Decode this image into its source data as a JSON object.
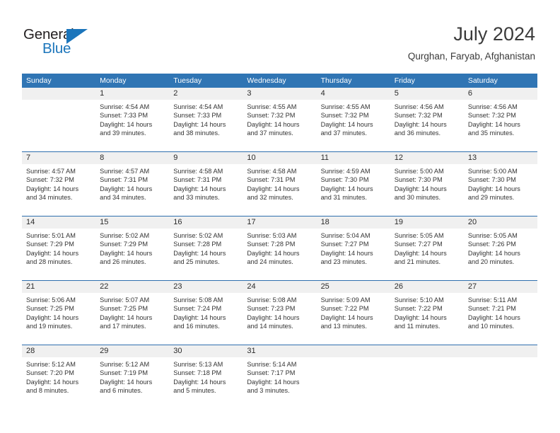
{
  "brand": {
    "name_part1": "General",
    "name_part2": "Blue",
    "triangle_color": "#1b75bb",
    "text_color": "#231f20"
  },
  "header": {
    "title": "July 2024",
    "location": "Qurghan, Faryab, Afghanistan"
  },
  "theme": {
    "header_blue": "#3075b4",
    "row_divider_blue": "#2f6fae",
    "day_band_gray": "#f0f0f0",
    "body_white": "#ffffff",
    "text_dark": "#333333"
  },
  "weekdays": [
    "Sunday",
    "Monday",
    "Tuesday",
    "Wednesday",
    "Thursday",
    "Friday",
    "Saturday"
  ],
  "weeks": [
    [
      {
        "day": "",
        "lines": [
          "",
          "",
          "",
          ""
        ],
        "empty": true
      },
      {
        "day": "1",
        "lines": [
          "Sunrise: 4:54 AM",
          "Sunset: 7:33 PM",
          "Daylight: 14 hours",
          "and 39 minutes."
        ],
        "empty": false
      },
      {
        "day": "2",
        "lines": [
          "Sunrise: 4:54 AM",
          "Sunset: 7:33 PM",
          "Daylight: 14 hours",
          "and 38 minutes."
        ],
        "empty": false
      },
      {
        "day": "3",
        "lines": [
          "Sunrise: 4:55 AM",
          "Sunset: 7:32 PM",
          "Daylight: 14 hours",
          "and 37 minutes."
        ],
        "empty": false
      },
      {
        "day": "4",
        "lines": [
          "Sunrise: 4:55 AM",
          "Sunset: 7:32 PM",
          "Daylight: 14 hours",
          "and 37 minutes."
        ],
        "empty": false
      },
      {
        "day": "5",
        "lines": [
          "Sunrise: 4:56 AM",
          "Sunset: 7:32 PM",
          "Daylight: 14 hours",
          "and 36 minutes."
        ],
        "empty": false
      },
      {
        "day": "6",
        "lines": [
          "Sunrise: 4:56 AM",
          "Sunset: 7:32 PM",
          "Daylight: 14 hours",
          "and 35 minutes."
        ],
        "empty": false
      }
    ],
    [
      {
        "day": "7",
        "lines": [
          "Sunrise: 4:57 AM",
          "Sunset: 7:32 PM",
          "Daylight: 14 hours",
          "and 34 minutes."
        ],
        "empty": false
      },
      {
        "day": "8",
        "lines": [
          "Sunrise: 4:57 AM",
          "Sunset: 7:31 PM",
          "Daylight: 14 hours",
          "and 34 minutes."
        ],
        "empty": false
      },
      {
        "day": "9",
        "lines": [
          "Sunrise: 4:58 AM",
          "Sunset: 7:31 PM",
          "Daylight: 14 hours",
          "and 33 minutes."
        ],
        "empty": false
      },
      {
        "day": "10",
        "lines": [
          "Sunrise: 4:58 AM",
          "Sunset: 7:31 PM",
          "Daylight: 14 hours",
          "and 32 minutes."
        ],
        "empty": false
      },
      {
        "day": "11",
        "lines": [
          "Sunrise: 4:59 AM",
          "Sunset: 7:30 PM",
          "Daylight: 14 hours",
          "and 31 minutes."
        ],
        "empty": false
      },
      {
        "day": "12",
        "lines": [
          "Sunrise: 5:00 AM",
          "Sunset: 7:30 PM",
          "Daylight: 14 hours",
          "and 30 minutes."
        ],
        "empty": false
      },
      {
        "day": "13",
        "lines": [
          "Sunrise: 5:00 AM",
          "Sunset: 7:30 PM",
          "Daylight: 14 hours",
          "and 29 minutes."
        ],
        "empty": false
      }
    ],
    [
      {
        "day": "14",
        "lines": [
          "Sunrise: 5:01 AM",
          "Sunset: 7:29 PM",
          "Daylight: 14 hours",
          "and 28 minutes."
        ],
        "empty": false
      },
      {
        "day": "15",
        "lines": [
          "Sunrise: 5:02 AM",
          "Sunset: 7:29 PM",
          "Daylight: 14 hours",
          "and 26 minutes."
        ],
        "empty": false
      },
      {
        "day": "16",
        "lines": [
          "Sunrise: 5:02 AM",
          "Sunset: 7:28 PM",
          "Daylight: 14 hours",
          "and 25 minutes."
        ],
        "empty": false
      },
      {
        "day": "17",
        "lines": [
          "Sunrise: 5:03 AM",
          "Sunset: 7:28 PM",
          "Daylight: 14 hours",
          "and 24 minutes."
        ],
        "empty": false
      },
      {
        "day": "18",
        "lines": [
          "Sunrise: 5:04 AM",
          "Sunset: 7:27 PM",
          "Daylight: 14 hours",
          "and 23 minutes."
        ],
        "empty": false
      },
      {
        "day": "19",
        "lines": [
          "Sunrise: 5:05 AM",
          "Sunset: 7:27 PM",
          "Daylight: 14 hours",
          "and 21 minutes."
        ],
        "empty": false
      },
      {
        "day": "20",
        "lines": [
          "Sunrise: 5:05 AM",
          "Sunset: 7:26 PM",
          "Daylight: 14 hours",
          "and 20 minutes."
        ],
        "empty": false
      }
    ],
    [
      {
        "day": "21",
        "lines": [
          "Sunrise: 5:06 AM",
          "Sunset: 7:25 PM",
          "Daylight: 14 hours",
          "and 19 minutes."
        ],
        "empty": false
      },
      {
        "day": "22",
        "lines": [
          "Sunrise: 5:07 AM",
          "Sunset: 7:25 PM",
          "Daylight: 14 hours",
          "and 17 minutes."
        ],
        "empty": false
      },
      {
        "day": "23",
        "lines": [
          "Sunrise: 5:08 AM",
          "Sunset: 7:24 PM",
          "Daylight: 14 hours",
          "and 16 minutes."
        ],
        "empty": false
      },
      {
        "day": "24",
        "lines": [
          "Sunrise: 5:08 AM",
          "Sunset: 7:23 PM",
          "Daylight: 14 hours",
          "and 14 minutes."
        ],
        "empty": false
      },
      {
        "day": "25",
        "lines": [
          "Sunrise: 5:09 AM",
          "Sunset: 7:22 PM",
          "Daylight: 14 hours",
          "and 13 minutes."
        ],
        "empty": false
      },
      {
        "day": "26",
        "lines": [
          "Sunrise: 5:10 AM",
          "Sunset: 7:22 PM",
          "Daylight: 14 hours",
          "and 11 minutes."
        ],
        "empty": false
      },
      {
        "day": "27",
        "lines": [
          "Sunrise: 5:11 AM",
          "Sunset: 7:21 PM",
          "Daylight: 14 hours",
          "and 10 minutes."
        ],
        "empty": false
      }
    ],
    [
      {
        "day": "28",
        "lines": [
          "Sunrise: 5:12 AM",
          "Sunset: 7:20 PM",
          "Daylight: 14 hours",
          "and 8 minutes."
        ],
        "empty": false
      },
      {
        "day": "29",
        "lines": [
          "Sunrise: 5:12 AM",
          "Sunset: 7:19 PM",
          "Daylight: 14 hours",
          "and 6 minutes."
        ],
        "empty": false
      },
      {
        "day": "30",
        "lines": [
          "Sunrise: 5:13 AM",
          "Sunset: 7:18 PM",
          "Daylight: 14 hours",
          "and 5 minutes."
        ],
        "empty": false
      },
      {
        "day": "31",
        "lines": [
          "Sunrise: 5:14 AM",
          "Sunset: 7:17 PM",
          "Daylight: 14 hours",
          "and 3 minutes."
        ],
        "empty": false
      },
      {
        "day": "",
        "lines": [
          "",
          "",
          "",
          ""
        ],
        "empty": true
      },
      {
        "day": "",
        "lines": [
          "",
          "",
          "",
          ""
        ],
        "empty": true
      },
      {
        "day": "",
        "lines": [
          "",
          "",
          "",
          ""
        ],
        "empty": true
      }
    ]
  ]
}
